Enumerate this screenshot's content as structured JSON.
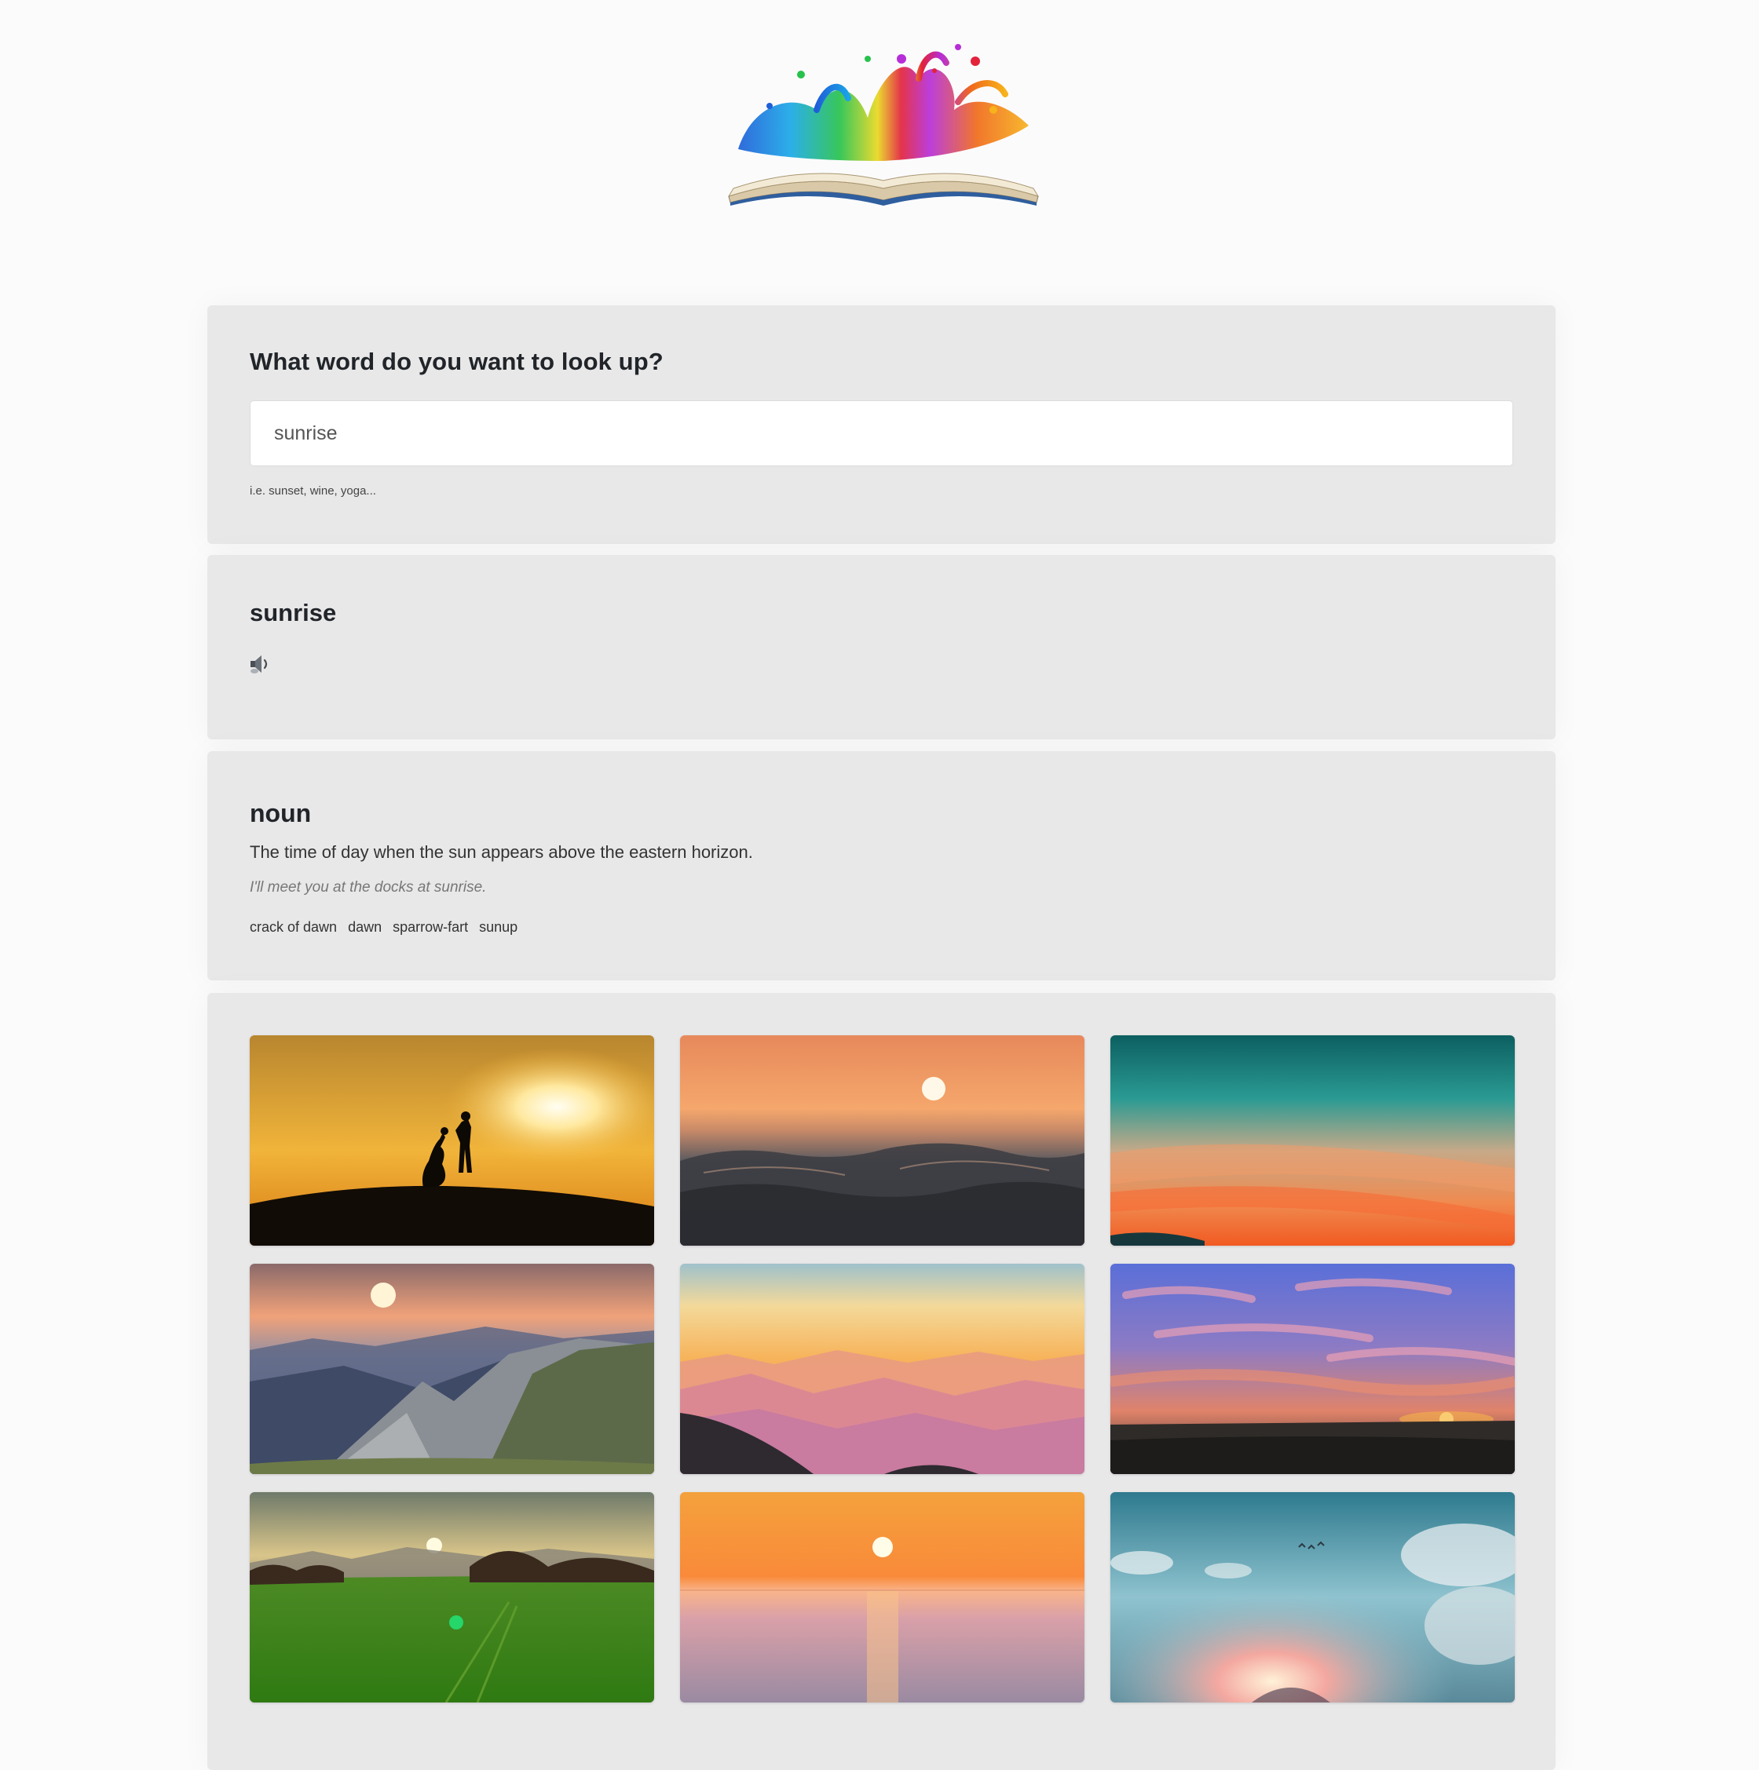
{
  "search": {
    "question": "What word do you want to look up?",
    "value": "sunrise",
    "hint": "i.e. sunset, wine, yoga..."
  },
  "word": {
    "title": "sunrise",
    "audio_icon": "speaker-icon"
  },
  "meaning": {
    "part_of_speech": "noun",
    "definition": "The time of day when the sun appears above the eastern horizon.",
    "example": "I'll meet you at the docks at sunrise.",
    "synonyms": [
      "crack of dawn",
      "dawn",
      "sparrow-fart",
      "sunup"
    ]
  },
  "gallery": {
    "images": [
      "couple-silhouette-sunrise",
      "ocean-wave-sunrise",
      "teal-orange-sky",
      "rocky-mountain-sunrise",
      "pastel-mountain-layers",
      "purple-sky-field-sunrise",
      "green-meadow-sunrise",
      "orange-sea-sunrise",
      "blue-sky-sunburst-clouds"
    ]
  },
  "colors": {
    "page_bg": "#fbfbfc",
    "card_bg": "#e9e8e9",
    "text": "#212529"
  }
}
